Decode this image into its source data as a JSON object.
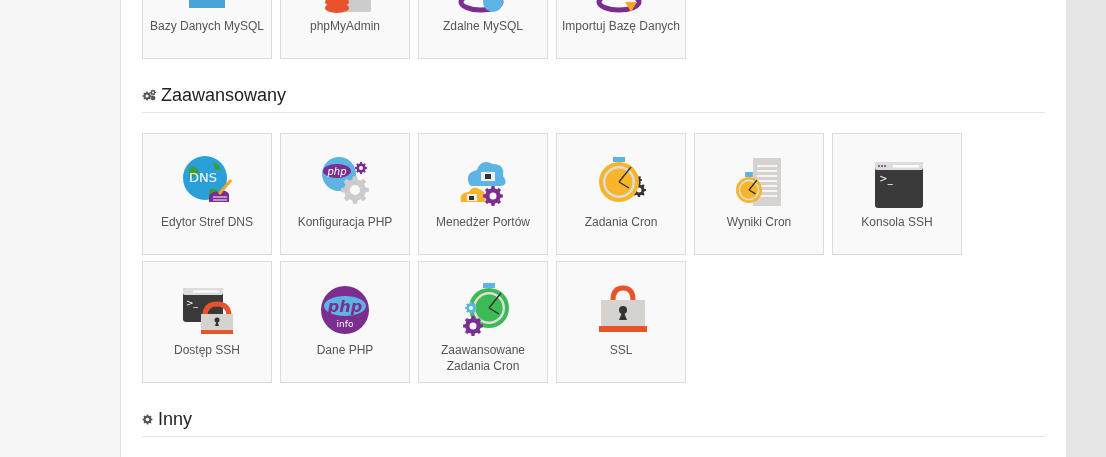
{
  "sections": [
    {
      "tiles": [
        {
          "label": "Bazy Danych MySQL"
        },
        {
          "label": "phpMyAdmin"
        },
        {
          "label": "Zdalne MySQL"
        },
        {
          "label": "Importuj Bazę Danych"
        }
      ]
    },
    {
      "title": "Zaawansowany",
      "tiles": [
        {
          "label": "Edytor Stref DNS",
          "icon_texts": [
            "DNS"
          ]
        },
        {
          "label": "Konfiguracja PHP",
          "icon_texts": [
            "php"
          ]
        },
        {
          "label": "Menedżer Portów"
        },
        {
          "label": "Zadania Cron"
        },
        {
          "label": "Wyniki Cron"
        },
        {
          "label": "Konsola SSH",
          "icon_texts": [
            ">_"
          ]
        },
        {
          "label": "Dostęp SSH",
          "icon_texts": [
            ">_"
          ]
        },
        {
          "label": "Dane PHP",
          "icon_texts": [
            "php",
            "info"
          ]
        },
        {
          "label": "Zaawansowane Zadania Cron"
        },
        {
          "label": "SSL"
        }
      ]
    },
    {
      "title": "Inny"
    }
  ]
}
